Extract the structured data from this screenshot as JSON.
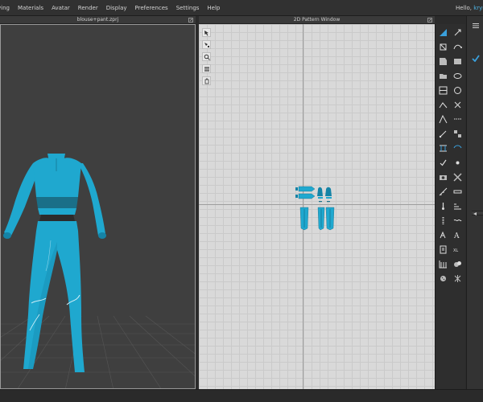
{
  "menu": {
    "items": [
      "ving",
      "Materials",
      "Avatar",
      "Render",
      "Display",
      "Preferences",
      "Settings",
      "Help"
    ]
  },
  "user": {
    "greeting": "Hello,",
    "name": "krymb"
  },
  "viewport3d": {
    "title": "blouse+pant.zprj"
  },
  "pattern_window": {
    "title": "2D Pattern Window"
  },
  "colors": {
    "garment": "#1fa8cf",
    "garment_shadow": "#1583a6",
    "accent": "#3aa0dc",
    "pattern_bg": "#d9d9d9"
  },
  "icons": {
    "pattern_tools": [
      "transform-pattern-icon",
      "edit-point-icon",
      "zoom-icon",
      "sewing-icon",
      "pin-icon"
    ],
    "right_toolbar": [
      "mode-icon",
      "layout-icon",
      "transform-icon",
      "edit-curve-icon",
      "polygon-icon",
      "rectangle-icon",
      "folder-icon",
      "ellipse-icon",
      "internal-line-icon",
      "circle-icon",
      "segment-icon",
      "cut-icon",
      "fold-icon",
      "seam-icon",
      "trim-icon",
      "arrange-icon",
      "line-sewing-icon",
      "free-sewing-icon",
      "sewing-check-icon",
      "tack-icon",
      "camera-icon",
      "fabric-icon",
      "measure-icon",
      "ruler-icon",
      "pin-tool-icon",
      "grading-icon",
      "zipper-icon",
      "elastic-icon",
      "annotation-icon",
      "text-icon",
      "note-icon",
      "size-icon",
      "grid-icon",
      "puckering-icon",
      "button-icon",
      "texture-icon"
    ]
  }
}
